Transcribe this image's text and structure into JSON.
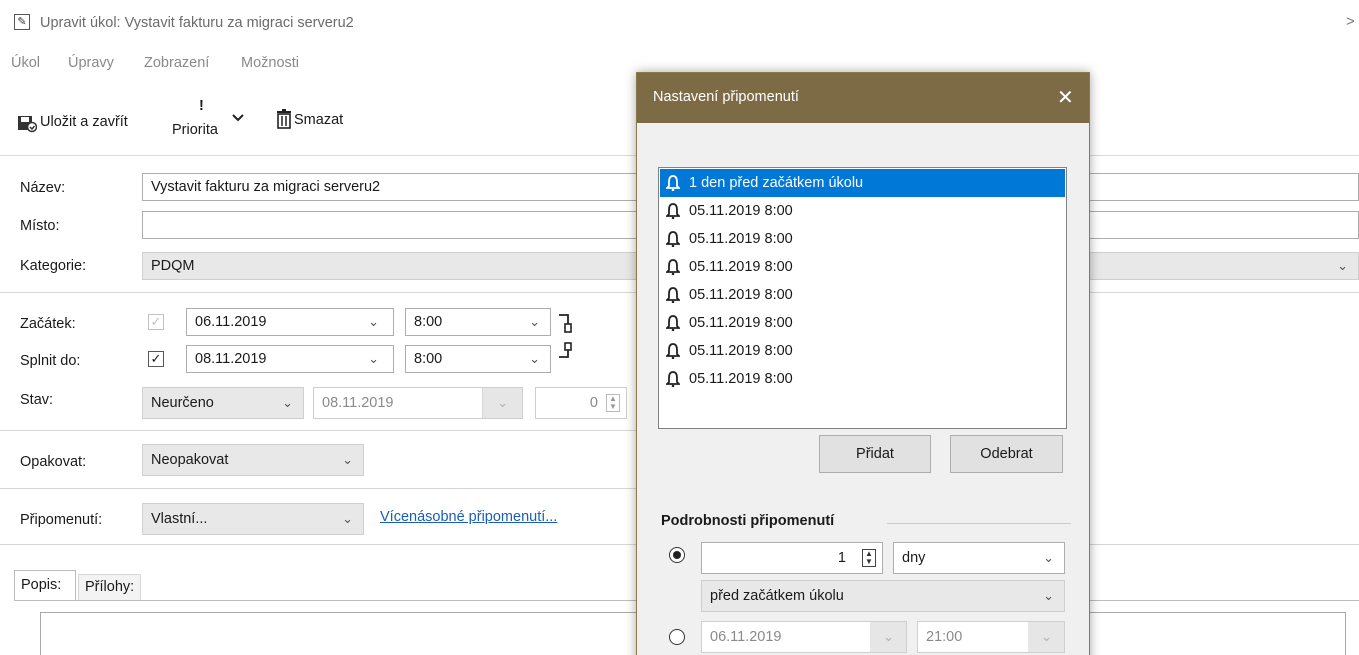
{
  "window": {
    "title": "Upravit úkol: Vystavit fakturu za migraci serveru2",
    "close_glyph": ">"
  },
  "menubar": {
    "items": [
      "Úkol",
      "Úpravy",
      "Zobrazení",
      "Možnosti"
    ],
    "underline": [
      "Ú",
      "r",
      "b",
      "M"
    ]
  },
  "toolbar": {
    "save_label": "Uložit a zavřít",
    "priority_mark": "!",
    "priority_label": "Priorita",
    "delete_label": "Smazat"
  },
  "form": {
    "name_label": "Název:",
    "name_value": "Vystavit fakturu za migraci serveru2",
    "place_label": "Místo:",
    "place_value": "",
    "category_label": "Kategorie:",
    "category_value": "PDQM",
    "start_label": "Začátek:",
    "start_date": "06.11.2019",
    "start_time": "8:00",
    "due_label": "Splnit do:",
    "due_date": "08.11.2019",
    "due_time": "8:00",
    "status_label": "Stav:",
    "status_value": "Neurčeno",
    "status_date": "08.11.2019",
    "percent_value": "0",
    "repeat_label": "Opakovat:",
    "repeat_value": "Neopakovat",
    "reminder_label": "Připomenutí:",
    "reminder_value": "Vlastní...",
    "multi_reminder_link": "Vícenásobné připomenutí...",
    "tab_description": "Popis:",
    "tab_attachments": "Přílohy:"
  },
  "dialog": {
    "title": "Nastavení připomenutí",
    "reminders": [
      "1 den před začátkem úkolu",
      "05.11.2019 8:00",
      "05.11.2019 8:00",
      "05.11.2019 8:00",
      "05.11.2019 8:00",
      "05.11.2019 8:00",
      "05.11.2019 8:00",
      "05.11.2019 8:00"
    ],
    "add_button": "Přidat",
    "remove_button": "Odebrat",
    "details_caption": "Podrobnosti připomenutí",
    "relative_amount": "1",
    "relative_unit": "dny",
    "relative_anchor": "před začátkem úkolu",
    "absolute_date": "06.11.2019",
    "absolute_time": "21:00"
  },
  "colors": {
    "dialog_title_bg": "#7d6b45",
    "selection": "#0078d7",
    "link": "#1a5fb4"
  }
}
